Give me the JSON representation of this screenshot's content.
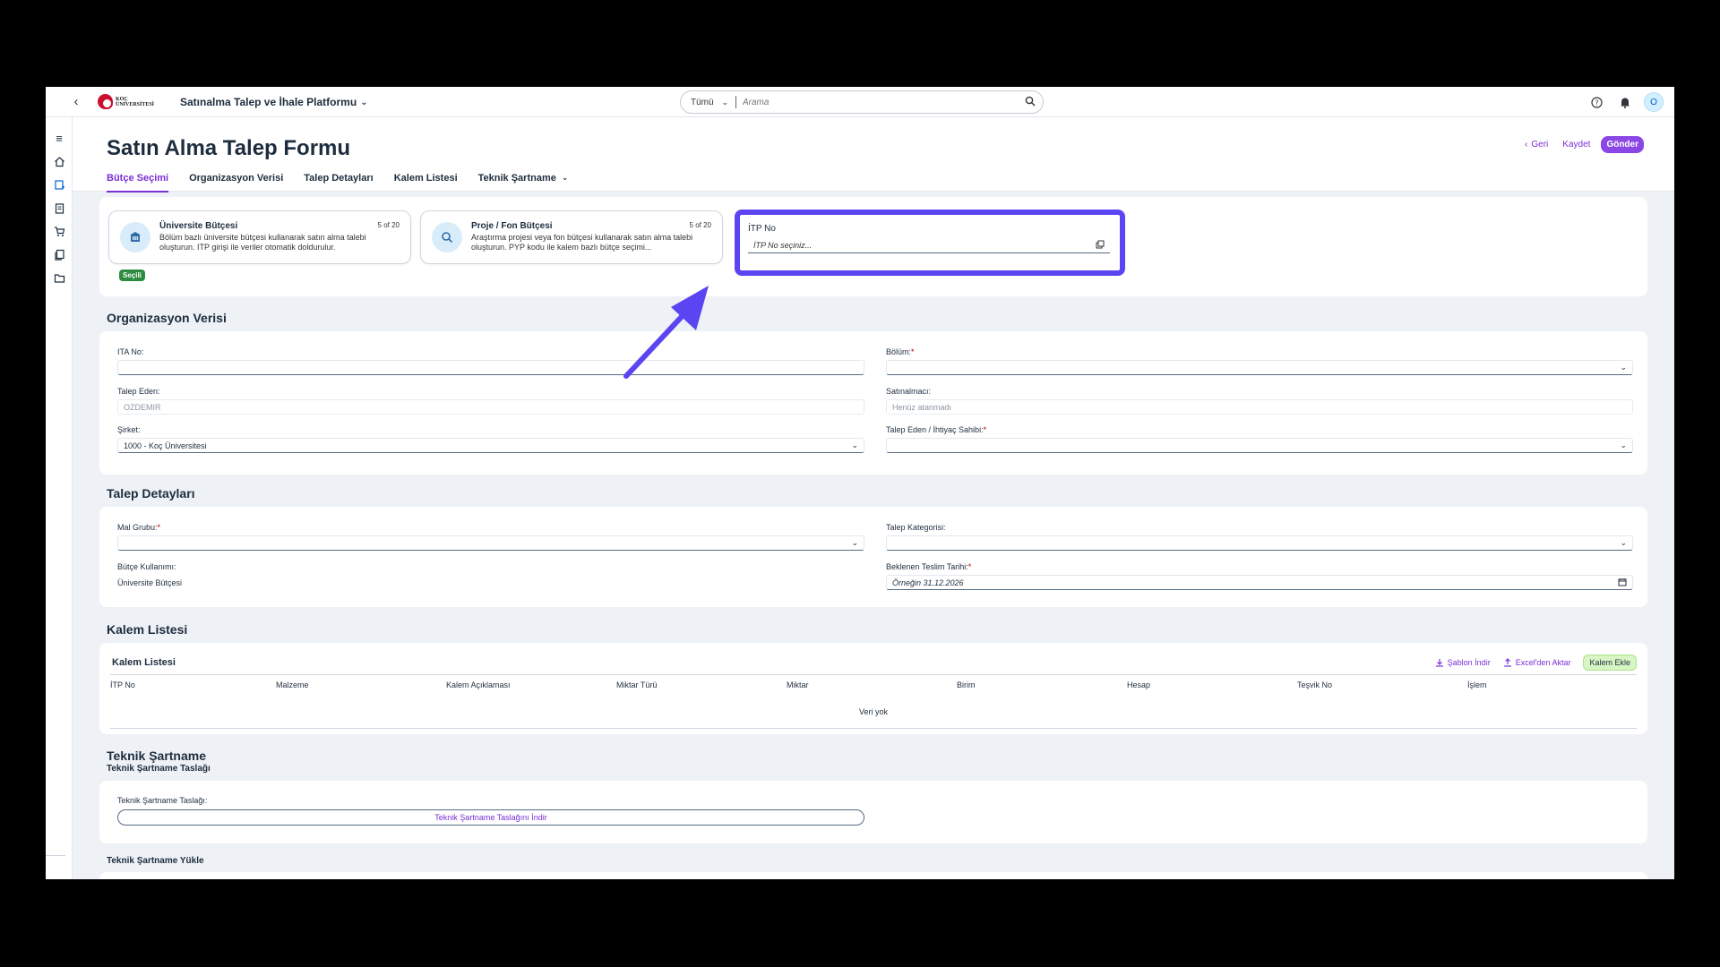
{
  "shell": {
    "logo_line1": "KOÇ",
    "logo_line2": "ÜNİVERSİTESİ",
    "app_title": "Satınalma Talep ve İhale Platformu",
    "search_scope": "Tümü",
    "search_placeholder": "Arama",
    "avatar_initial": "O"
  },
  "page": {
    "title": "Satın Alma Talep Formu",
    "actions": {
      "back": "Geri",
      "save": "Kaydet",
      "send": "Gönder"
    },
    "tabs": [
      "Bütçe Seçimi",
      "Organizasyon Verisi",
      "Talep Detayları",
      "Kalem Listesi",
      "Teknik Şartname"
    ]
  },
  "budget": {
    "cards": [
      {
        "title": "Üniversite Bütçesi",
        "count": "5 of 20",
        "desc": "Bölüm bazlı üniversite bütçesi kullanarak satın alma talebi oluşturun. ITP girişi ile veriler otomatik doldurulur."
      },
      {
        "title": "Proje / Fon Bütçesi",
        "count": "5 of 20",
        "desc": "Araştırma projesi veya fon bütçesi kullanarak satın alma talebi oluşturun. PYP kodu ile kalem bazlı bütçe seçimi..."
      }
    ],
    "selected_badge": "Seçili",
    "itp_label": "İTP No",
    "itp_placeholder": "İTP No seçiniz..."
  },
  "org": {
    "title": "Organizasyon Verisi",
    "ita_label": "ITA No:",
    "bolum_label": "Bölüm:",
    "talep_eden_label": "Talep Eden:",
    "talep_eden_value": "OZDEMIR",
    "satinalmaci_label": "Satınalmacı:",
    "satinalmaci_value": "Henüz atanmadı",
    "sirket_label": "Şirket:",
    "sirket_value": "1000 - Koç Üniversitesi",
    "ihtiyac_label": "Talep Eden / İhtiyaç Sahibi:"
  },
  "details": {
    "title": "Talep Detayları",
    "mal_grubu_label": "Mal Grubu:",
    "kategori_label": "Talep Kategorisi:",
    "butce_kullanimi_label": "Bütçe Kullanımı:",
    "butce_kullanimi_value": "Üniversite Bütçesi",
    "teslim_label": "Beklenen Teslim Tarihi:",
    "teslim_placeholder": "Örneğin 31.12.2026"
  },
  "items": {
    "section_title": "Kalem Listesi",
    "table_title": "Kalem Listesi",
    "download_template": "Şablon İndir",
    "excel_import": "Excel'den Aktar",
    "add_item": "Kalem Ekle",
    "columns": [
      "İTP No",
      "Malzeme",
      "Kalem Açıklaması",
      "Miktar Türü",
      "Miktar",
      "Birim",
      "Hesap",
      "Teşvik No",
      "İşlem"
    ],
    "empty": "Veri yok"
  },
  "spec": {
    "title": "Teknik Şartname",
    "draft_subtitle": "Teknik Şartname Taslağı",
    "draft_label": "Teknik Şartname Taslağı:",
    "draft_download": "Teknik Şartname Taslağını İndir",
    "upload_subtitle": "Teknik Şartname Yükle"
  },
  "colors": {
    "accent": "#7a2ed6",
    "highlight": "#5b45f2",
    "selected_badge": "#2c8b3e"
  },
  "icons": [
    "back-icon",
    "search-icon",
    "help-icon",
    "bell-icon",
    "menu-icon",
    "home-icon",
    "request-icon",
    "clipboard-icon",
    "cart-icon",
    "documents-icon",
    "folder-icon",
    "building-icon",
    "magnifier-icon",
    "value-help-icon",
    "calendar-icon",
    "download-icon",
    "upload-icon"
  ]
}
